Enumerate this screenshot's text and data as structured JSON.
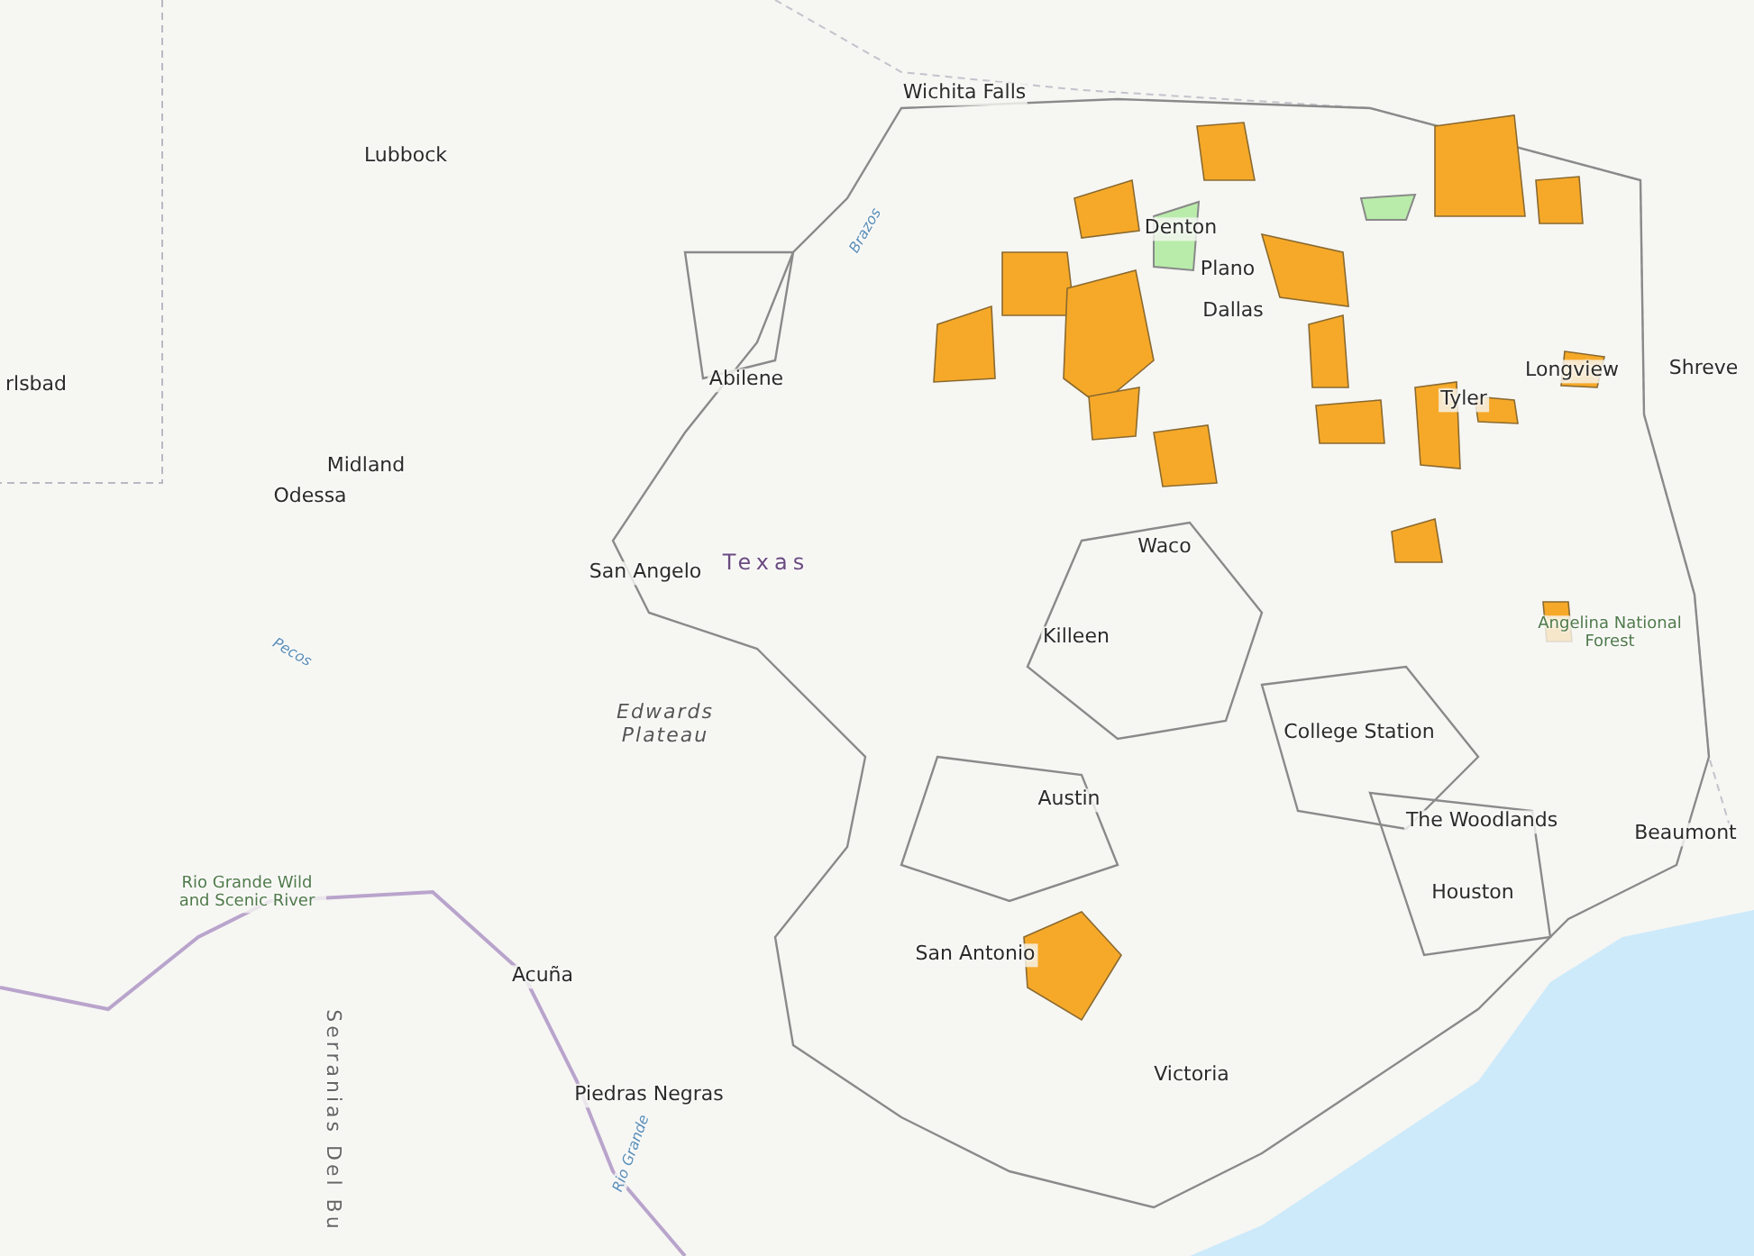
{
  "map": {
    "labels": [
      {
        "text": "Wichita Falls",
        "kind": "city"
      },
      {
        "text": "Lubbock",
        "kind": "city"
      },
      {
        "text": "Denton",
        "kind": "city"
      },
      {
        "text": "Plano",
        "kind": "city"
      },
      {
        "text": "Dallas",
        "kind": "city"
      },
      {
        "text": "Longview",
        "kind": "city"
      },
      {
        "text": "Shreve",
        "kind": "city"
      },
      {
        "text": "Abilene",
        "kind": "city"
      },
      {
        "text": "Tyler",
        "kind": "city"
      },
      {
        "text": "rlsbad",
        "kind": "city"
      },
      {
        "text": "Midland",
        "kind": "city"
      },
      {
        "text": "Odessa",
        "kind": "city"
      },
      {
        "text": "San Angelo",
        "kind": "city"
      },
      {
        "text": "Texas",
        "kind": "state"
      },
      {
        "text": "Waco",
        "kind": "city"
      },
      {
        "text": "Killeen",
        "kind": "city"
      },
      {
        "text": "Angelina National Forest",
        "kind": "park"
      },
      {
        "text": "Edwards Plateau",
        "kind": "region"
      },
      {
        "text": "College Station",
        "kind": "city"
      },
      {
        "text": "Austin",
        "kind": "city"
      },
      {
        "text": "The Woodlands",
        "kind": "city"
      },
      {
        "text": "Beaumont",
        "kind": "city"
      },
      {
        "text": "Rio Grande Wild and Scenic River",
        "kind": "park"
      },
      {
        "text": "Houston",
        "kind": "city"
      },
      {
        "text": "San Antonio",
        "kind": "city"
      },
      {
        "text": "Acuña",
        "kind": "city"
      },
      {
        "text": "Victoria",
        "kind": "city"
      },
      {
        "text": "Piedras Negras",
        "kind": "city"
      },
      {
        "text": "Serranias Del Bu",
        "kind": "range"
      },
      {
        "text": "Brazos",
        "kind": "river"
      },
      {
        "text": "Pecos",
        "kind": "river"
      },
      {
        "text": "Rio Grande",
        "kind": "river"
      }
    ]
  }
}
